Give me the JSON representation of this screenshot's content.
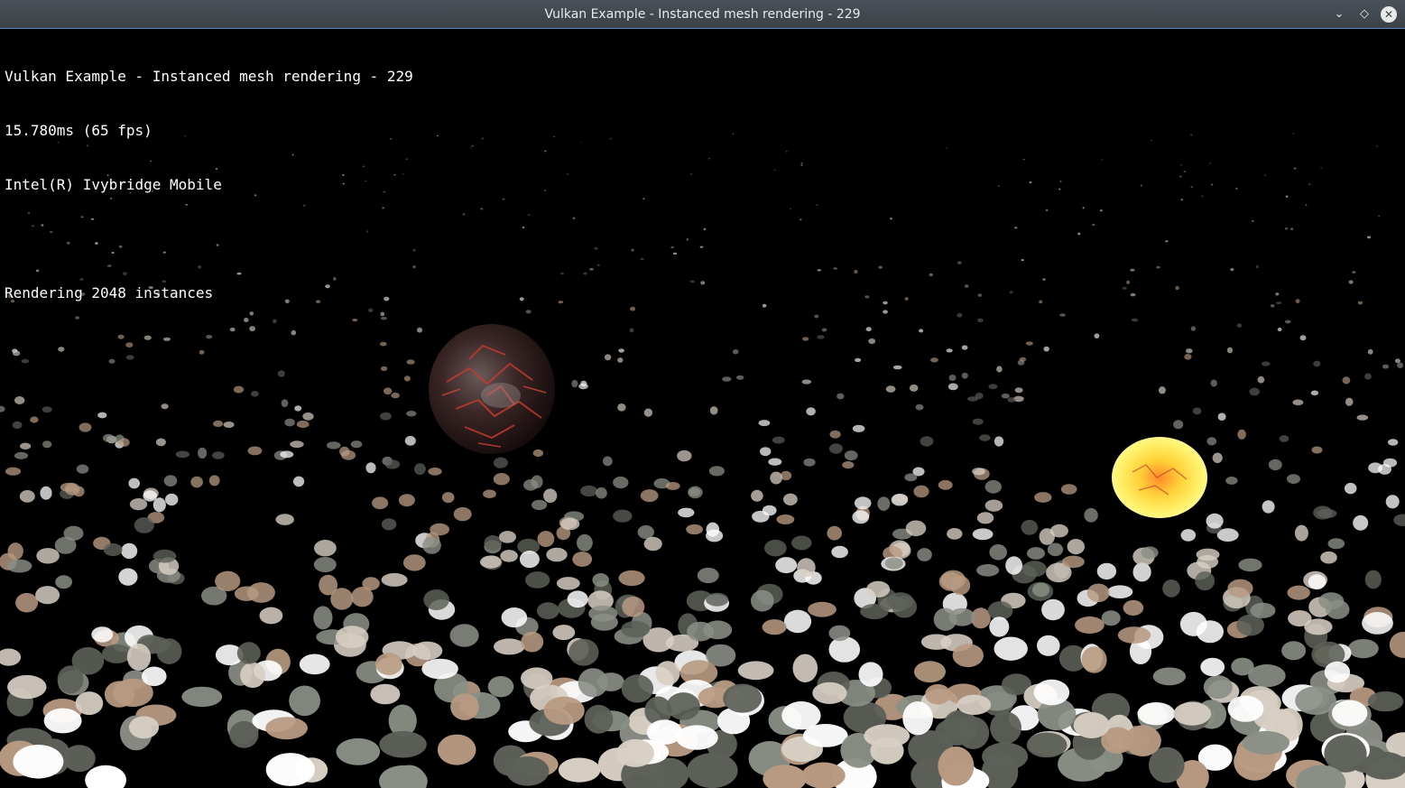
{
  "window": {
    "title": "Vulkan Example - Instanced mesh rendering - 229",
    "buttons": {
      "minimize_icon": "chevron-down-icon",
      "maximize_icon": "diamond-icon",
      "close_icon": "close-icon"
    }
  },
  "overlay": {
    "title_line": "Vulkan Example - Instanced mesh rendering - 229",
    "frame_time": "15.780ms (65 fps)",
    "gpu": "Intel(R) Ivybridge Mobile",
    "instances": "Rendering 2048 instances"
  },
  "scene": {
    "instance_count": 2048,
    "planet_colors": [
      "#2a1a1a",
      "#c0392b"
    ],
    "sun_colors": [
      "#fff27a",
      "#e67e22"
    ],
    "rock_colors": [
      "#ffffff",
      "#d8cfc4",
      "#b89a82",
      "#8a8f86",
      "#5c6058"
    ]
  },
  "colors": {
    "titlebar": "#41484e",
    "accent": "#5a87b8",
    "text": "#ffffff",
    "background": "#000000"
  }
}
